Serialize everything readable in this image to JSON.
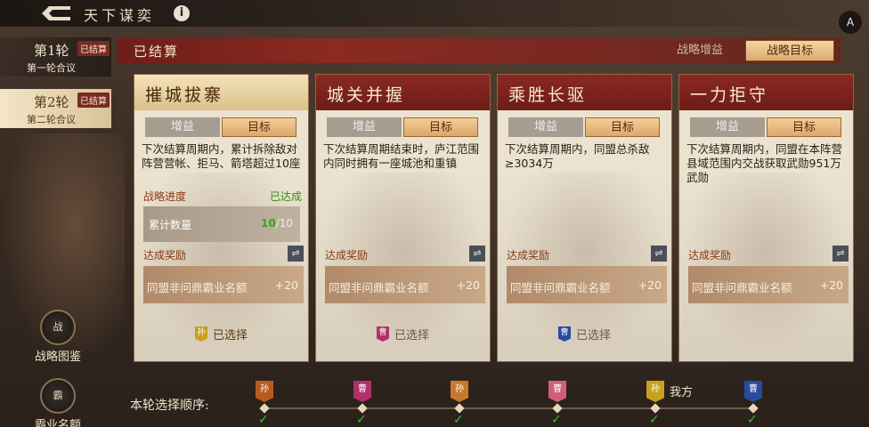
{
  "header": {
    "app_title": "天下谋奕",
    "info_icon": "i",
    "corner_icon": "A"
  },
  "rounds": [
    {
      "name": "第1轮",
      "sub": "第一轮合议",
      "badge": "已结算"
    },
    {
      "name": "第2轮",
      "sub": "第二轮合议",
      "badge": "已结算"
    }
  ],
  "side_buttons": [
    {
      "label": "战略图鉴",
      "icon": "战"
    },
    {
      "label": "霸业名额",
      "icon": "霸"
    }
  ],
  "panel": {
    "title": "已结算",
    "tabs": [
      "战略增益",
      "战略目标"
    ]
  },
  "cards": [
    {
      "title": "摧城拔寨",
      "tab_a": "增益",
      "tab_b": "目标",
      "desc": "下次结算周期内，累计拆除敌对阵营营帐、拒马、箭塔超过10座",
      "progress_label": "战略进度",
      "progress_status": "已达成",
      "count_label": "累计数量",
      "count_value": "10",
      "count_total": "/10",
      "reward_label": "达成奖励",
      "reward_name": "同盟非问鼎霸业名额",
      "reward_value": "+20",
      "chosen_flag": "孙",
      "chosen_text": "已选择"
    },
    {
      "title": "城关并握",
      "tab_a": "增益",
      "tab_b": "目标",
      "desc": "下次结算周期结束时，庐江范围内同时拥有一座城池和重镇",
      "reward_label": "达成奖励",
      "reward_name": "同盟非问鼎霸业名额",
      "reward_value": "+20",
      "chosen_flag": "曹",
      "chosen_text": "已选择"
    },
    {
      "title": "乘胜长驱",
      "tab_a": "增益",
      "tab_b": "目标",
      "desc": "下次结算周期内，同盟总杀敌≥3034万",
      "reward_label": "达成奖励",
      "reward_name": "同盟非问鼎霸业名额",
      "reward_value": "+20",
      "chosen_flag": "曹",
      "chosen_text": "已选择"
    },
    {
      "title": "一力拒守",
      "tab_a": "增益",
      "tab_b": "目标",
      "desc": "下次结算周期内，同盟在本阵营县域范围内交战获取武勋951万武勋",
      "reward_label": "达成奖励",
      "reward_name": "同盟非问鼎霸业名额",
      "reward_value": "+20"
    }
  ],
  "order": {
    "label": "本轮选择顺序:",
    "items": [
      {
        "flag": "孙",
        "color": "#b85a20"
      },
      {
        "flag": "曹",
        "color": "#b0306a"
      },
      {
        "flag": "孙",
        "color": "#c8782a"
      },
      {
        "flag": "曹",
        "color": "#d0607a"
      },
      {
        "flag": "孙",
        "color": "#c8a020",
        "me": "我方"
      },
      {
        "flag": "曹",
        "color": "#2a4aa0"
      }
    ],
    "check": "✓"
  },
  "colors": {
    "flag_sun_card": "#c8a020",
    "flag_cao_card2": "#b0306a",
    "flag_cao_card3": "#2a4aa0"
  }
}
